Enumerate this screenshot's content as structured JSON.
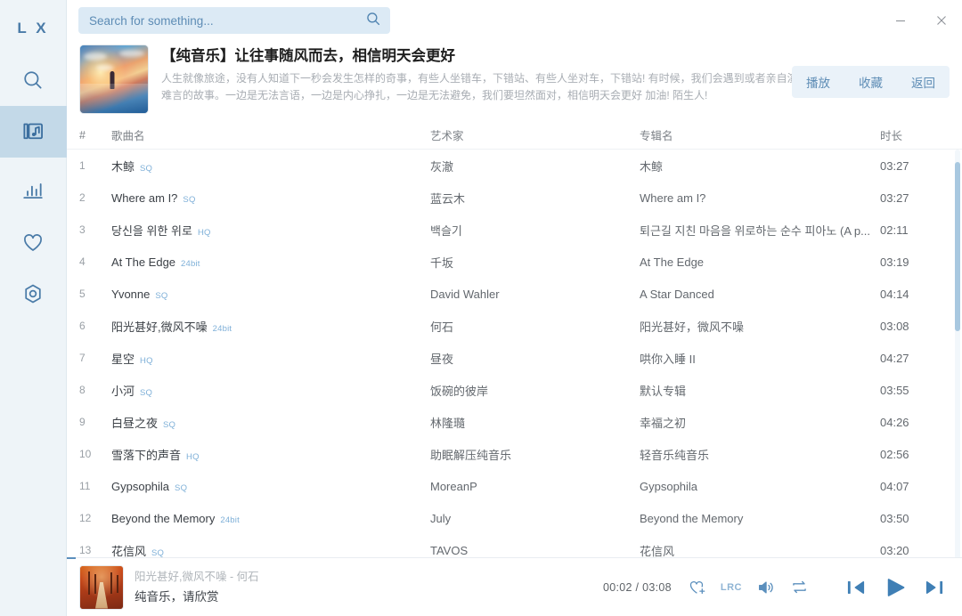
{
  "window": {
    "minimize_label": "−",
    "close_label": "✕"
  },
  "search": {
    "placeholder": "Search for something...",
    "value": ""
  },
  "sidebar": {
    "logo": "L X",
    "items": [
      {
        "name": "search",
        "label": "Search",
        "icon": "search-icon",
        "active": false
      },
      {
        "name": "songlist",
        "label": "Song List",
        "icon": "music-list-icon",
        "active": true
      },
      {
        "name": "ranking",
        "label": "Ranking",
        "icon": "bar-chart-icon",
        "active": false
      },
      {
        "name": "favorites",
        "label": "Favorites",
        "icon": "heart-icon",
        "active": false
      },
      {
        "name": "settings",
        "label": "Settings",
        "icon": "hexagon-gear-icon",
        "active": false
      }
    ]
  },
  "playlist": {
    "title": "【纯音乐】让往事随风而去，相信明天会更好",
    "description": "人生就像旅途，没有人知道下一秒会发生怎样的奇事，有些人坐错车，下错站、有些人坐对车，下错站! 有时候，我们会遇到或者亲自演绎一些难言的故事。一边是无法言语，一边是内心挣扎，一边是无法避免，我们要坦然面对，相信明天会更好 加油!  陌生人!",
    "actions": [
      {
        "name": "play",
        "label": "播放"
      },
      {
        "name": "favorite",
        "label": "收藏"
      },
      {
        "name": "back",
        "label": "返回"
      }
    ]
  },
  "table": {
    "columns": {
      "index": "#",
      "name": "歌曲名",
      "artist": "艺术家",
      "album": "专辑名",
      "duration": "时长"
    },
    "rows": [
      {
        "index": "1",
        "name": "木鲸",
        "badge": "SQ",
        "artist": "灰澈",
        "album": "木鲸",
        "duration": "03:27"
      },
      {
        "index": "2",
        "name": "Where am I?",
        "badge": "SQ",
        "artist": "蓝云木",
        "album": "Where am I?",
        "duration": "03:27"
      },
      {
        "index": "3",
        "name": "당신을 위한 위로",
        "badge": "HQ",
        "artist": "백슬기",
        "album": "퇴근길 지친 마음을 위로하는 순수 피아노 (A p...",
        "duration": "02:11"
      },
      {
        "index": "4",
        "name": "At The Edge",
        "badge": "24bit",
        "artist": "千坂",
        "album": "At The Edge",
        "duration": "03:19"
      },
      {
        "index": "5",
        "name": "Yvonne",
        "badge": "SQ",
        "artist": "David Wahler",
        "album": "A Star Danced",
        "duration": "04:14"
      },
      {
        "index": "6",
        "name": "阳光甚好,微风不噪",
        "badge": "24bit",
        "artist": "何石",
        "album": "阳光甚好，微风不噪",
        "duration": "03:08"
      },
      {
        "index": "7",
        "name": "星空",
        "badge": "HQ",
        "artist": "昼夜",
        "album": "哄你入睡 II",
        "duration": "04:27"
      },
      {
        "index": "8",
        "name": "小河",
        "badge": "SQ",
        "artist": "饭碗的彼岸",
        "album": "默认专辑",
        "duration": "03:55"
      },
      {
        "index": "9",
        "name": "白昼之夜",
        "badge": "SQ",
        "artist": "林隆瓍",
        "album": "幸福之初",
        "duration": "04:26"
      },
      {
        "index": "10",
        "name": "雪落下的声音",
        "badge": "HQ",
        "artist": "助眠解压纯音乐",
        "album": "轻音乐纯音乐",
        "duration": "02:56"
      },
      {
        "index": "11",
        "name": "Gypsophila",
        "badge": "SQ",
        "artist": "MoreanP",
        "album": "Gypsophila",
        "duration": "04:07"
      },
      {
        "index": "12",
        "name": "Beyond the Memory",
        "badge": "24bit",
        "artist": "July",
        "album": "Beyond the Memory",
        "duration": "03:50"
      },
      {
        "index": "13",
        "name": "花信风",
        "badge": "SQ",
        "artist": "TAVOS",
        "album": "花信风",
        "duration": "03:20"
      }
    ]
  },
  "player": {
    "song": "阳光甚好,微风不噪 - 何石",
    "lyric": "纯音乐，请欣赏",
    "time": "00:02 / 03:08",
    "current_time": "00:02",
    "total_time": "03:08",
    "progress_percent": 1,
    "controls": [
      {
        "name": "add-favorite",
        "icon": "heart-plus-icon"
      },
      {
        "name": "lyrics",
        "icon": "lrc-icon",
        "label": "LRC"
      },
      {
        "name": "volume",
        "icon": "volume-icon"
      },
      {
        "name": "repeat",
        "icon": "repeat-icon"
      },
      {
        "name": "previous",
        "icon": "previous-icon"
      },
      {
        "name": "play",
        "icon": "play-icon"
      },
      {
        "name": "next",
        "icon": "next-icon"
      }
    ]
  },
  "colors": {
    "accent": "#5b8fbd",
    "sidebar_bg": "#eef4f8",
    "sidebar_active": "#c3d9e8",
    "search_bg": "#dceaf5",
    "badge": "#7fb0d8"
  }
}
